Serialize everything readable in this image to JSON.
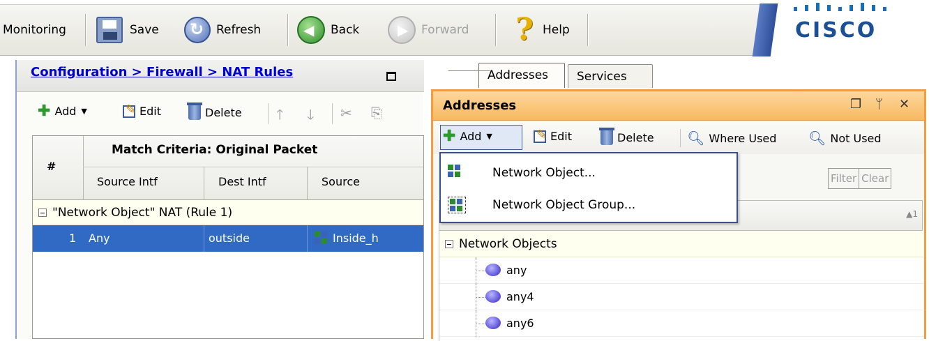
{
  "toolbar": {
    "monitoring_label": "Monitoring",
    "save_label": "Save",
    "refresh_label": "Refresh",
    "back_label": "Back",
    "forward_label": "Forward",
    "help_label": "Help",
    "help_glyph": "?"
  },
  "brand": {
    "logo_text": "CISCO",
    "color": "#1b4f96"
  },
  "left_panel": {
    "breadcrumb": "Configuration > Firewall > NAT Rules",
    "toolbar": {
      "add_label": "Add",
      "edit_label": "Edit",
      "delete_label": "Delete"
    },
    "table": {
      "num_header": "#",
      "group_header": "Match Criteria: Original Packet",
      "columns": [
        "Source Intf",
        "Dest Intf",
        "Source"
      ],
      "group_row": "\"Network Object\" NAT (Rule 1)",
      "rows": [
        {
          "num": "1",
          "source_intf": "Any",
          "dest_intf": "outside",
          "source": "Inside_h"
        }
      ]
    }
  },
  "right_panel": {
    "tabs": [
      "Addresses",
      "Services"
    ],
    "active_tab": "Addresses",
    "title": "Addresses",
    "window_controls": [
      "restore-icon",
      "pin-icon",
      "close-icon"
    ],
    "toolbar": {
      "add_label": "Add",
      "edit_label": "Edit",
      "delete_label": "Delete",
      "where_used_label": "Where Used",
      "not_used_label": "Not Used"
    },
    "filter": {
      "filter_label": "Filter",
      "clear_label": "Clear"
    },
    "list_sort": "1",
    "tree": {
      "group_label": "Network Objects",
      "items": [
        "any",
        "any4",
        "any6"
      ]
    }
  },
  "dropdown": {
    "items": [
      "Network Object...",
      "Network Object Group..."
    ]
  },
  "colors": {
    "selection": "#316ac5",
    "panel_border_active": "#f39c42",
    "link": "#0000cc"
  }
}
